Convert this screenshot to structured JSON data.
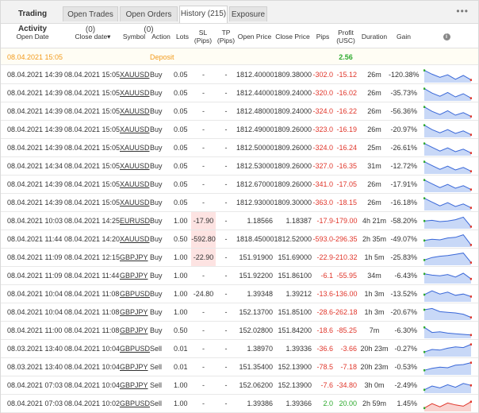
{
  "tabs": [
    {
      "label": "Trading Activity",
      "kind": "title"
    },
    {
      "label": "Open Trades (0)",
      "kind": "normal"
    },
    {
      "label": "Open Orders (0)",
      "kind": "normal"
    },
    {
      "label": "History (215)",
      "kind": "active"
    },
    {
      "label": "Exposure",
      "kind": "normal"
    }
  ],
  "more_label": "•••",
  "columns": {
    "open_date": "Open Date",
    "close_date": "Close date",
    "symbol": "Symbol",
    "action": "Action",
    "lots": "Lots",
    "sl": "SL (Pips)",
    "tp": "TP (Pips)",
    "open_price": "Open Price",
    "close_price": "Close Price",
    "pips": "Pips",
    "profit": "Profit (USC)",
    "duration": "Duration",
    "gain": "Gain"
  },
  "sort_indicator": "▾",
  "deposit": {
    "date": "08.04.2021 15:05",
    "label": "Deposit",
    "amount": "2.56"
  },
  "colors": {
    "red": "#e0362b",
    "green": "#2eaa2e",
    "orange": "#f29b1d",
    "line_blue": "#3a68d8",
    "fill_blue": "#c8d8f7",
    "line_red": "#e0362b",
    "fill_red": "#f9d3d0"
  },
  "trades": [
    {
      "open": "08.04.2021 14:39",
      "close": "08.04.2021 15:05",
      "symbol": "XAUUSD",
      "action": "Buy",
      "lots": "0.05",
      "sl": "-",
      "tp": "-",
      "open_price": "1812.40000",
      "close_price": "1809.38000",
      "pips": "-302.0",
      "profit": "-15.12",
      "duration": "26m",
      "gain": "-120.38%",
      "spark": [
        0.9,
        0.6,
        0.35,
        0.55,
        0.2,
        0.5,
        0.15
      ]
    },
    {
      "open": "08.04.2021 14:39",
      "close": "08.04.2021 15:05",
      "symbol": "XAUUSD",
      "action": "Buy",
      "lots": "0.05",
      "sl": "-",
      "tp": "-",
      "open_price": "1812.44000",
      "close_price": "1809.24000",
      "pips": "-320.0",
      "profit": "-16.02",
      "duration": "26m",
      "gain": "-35.73%",
      "spark": [
        0.9,
        0.55,
        0.3,
        0.6,
        0.25,
        0.5,
        0.15
      ]
    },
    {
      "open": "08.04.2021 14:39",
      "close": "08.04.2021 15:05",
      "symbol": "XAUUSD",
      "action": "Buy",
      "lots": "0.05",
      "sl": "-",
      "tp": "-",
      "open_price": "1812.48000",
      "close_price": "1809.24000",
      "pips": "-324.0",
      "profit": "-16.22",
      "duration": "26m",
      "gain": "-56.36%",
      "spark": [
        0.9,
        0.55,
        0.3,
        0.6,
        0.25,
        0.45,
        0.15
      ]
    },
    {
      "open": "08.04.2021 14:39",
      "close": "08.04.2021 15:05",
      "symbol": "XAUUSD",
      "action": "Buy",
      "lots": "0.05",
      "sl": "-",
      "tp": "-",
      "open_price": "1812.49000",
      "close_price": "1809.26000",
      "pips": "-323.0",
      "profit": "-16.19",
      "duration": "26m",
      "gain": "-20.97%",
      "spark": [
        0.9,
        0.55,
        0.3,
        0.55,
        0.25,
        0.45,
        0.15
      ]
    },
    {
      "open": "08.04.2021 14:39",
      "close": "08.04.2021 15:05",
      "symbol": "XAUUSD",
      "action": "Buy",
      "lots": "0.05",
      "sl": "-",
      "tp": "-",
      "open_price": "1812.50000",
      "close_price": "1809.26000",
      "pips": "-324.0",
      "profit": "-16.24",
      "duration": "25m",
      "gain": "-26.61%",
      "spark": [
        0.9,
        0.6,
        0.3,
        0.55,
        0.25,
        0.45,
        0.15
      ]
    },
    {
      "open": "08.04.2021 14:34",
      "close": "08.04.2021 15:05",
      "symbol": "XAUUSD",
      "action": "Buy",
      "lots": "0.05",
      "sl": "-",
      "tp": "-",
      "open_price": "1812.53000",
      "close_price": "1809.26000",
      "pips": "-327.0",
      "profit": "-16.35",
      "duration": "31m",
      "gain": "-12.72%",
      "spark": [
        0.9,
        0.6,
        0.3,
        0.55,
        0.25,
        0.45,
        0.15
      ]
    },
    {
      "open": "08.04.2021 14:39",
      "close": "08.04.2021 15:05",
      "symbol": "XAUUSD",
      "action": "Buy",
      "lots": "0.05",
      "sl": "-",
      "tp": "-",
      "open_price": "1812.67000",
      "close_price": "1809.26000",
      "pips": "-341.0",
      "profit": "-17.05",
      "duration": "26m",
      "gain": "-17.91%",
      "spark": [
        0.9,
        0.6,
        0.3,
        0.55,
        0.25,
        0.45,
        0.15
      ]
    },
    {
      "open": "08.04.2021 14:39",
      "close": "08.04.2021 15:05",
      "symbol": "XAUUSD",
      "action": "Buy",
      "lots": "0.05",
      "sl": "-",
      "tp": "-",
      "open_price": "1812.93000",
      "close_price": "1809.30000",
      "pips": "-363.0",
      "profit": "-18.15",
      "duration": "26m",
      "gain": "-16.18%",
      "spark": [
        0.9,
        0.6,
        0.3,
        0.55,
        0.25,
        0.45,
        0.15
      ]
    },
    {
      "open": "08.04.2021 10:03",
      "close": "08.04.2021 14:25",
      "symbol": "EURUSD",
      "action": "Buy",
      "lots": "1.00",
      "sl": "-17.90",
      "tp": "-",
      "open_price": "1.18566",
      "close_price": "1.18387",
      "pips": "-17.9",
      "profit": "-179.00",
      "duration": "4h 21m",
      "gain": "-58.20%",
      "spark": [
        0.55,
        0.6,
        0.5,
        0.55,
        0.65,
        0.85,
        0.1
      ]
    },
    {
      "open": "08.04.2021 11:44",
      "close": "08.04.2021 14:20",
      "symbol": "XAUUSD",
      "action": "Buy",
      "lots": "0.50",
      "sl": "-592.80",
      "tp": "-",
      "open_price": "1818.45000",
      "close_price": "1812.52000",
      "pips": "-593.0",
      "profit": "-296.35",
      "duration": "2h 35m",
      "gain": "-49.07%",
      "spark": [
        0.45,
        0.55,
        0.5,
        0.65,
        0.7,
        0.9,
        0.1
      ]
    },
    {
      "open": "08.04.2021 11:09",
      "close": "08.04.2021 12:15",
      "symbol": "GBPJPY",
      "action": "Buy",
      "lots": "1.00",
      "sl": "-22.90",
      "tp": "-",
      "open_price": "151.91900",
      "close_price": "151.69000",
      "pips": "-22.9",
      "profit": "-210.32",
      "duration": "1h 5m",
      "gain": "-25.83%",
      "spark": [
        0.35,
        0.55,
        0.65,
        0.7,
        0.8,
        0.9,
        0.15
      ]
    },
    {
      "open": "08.04.2021 11:09",
      "close": "08.04.2021 11:44",
      "symbol": "GBPJPY",
      "action": "Buy",
      "lots": "1.00",
      "sl": "-",
      "tp": "-",
      "open_price": "151.92200",
      "close_price": "151.86100",
      "pips": "-6.1",
      "profit": "-55.95",
      "duration": "34m",
      "gain": "-6.43%",
      "spark": [
        0.7,
        0.6,
        0.55,
        0.65,
        0.45,
        0.75,
        0.3
      ]
    },
    {
      "open": "08.04.2021 10:04",
      "close": "08.04.2021 11:08",
      "symbol": "GBPUSD",
      "action": "Buy",
      "lots": "1.00",
      "sl": "-24.80",
      "tp": "-",
      "open_price": "1.39348",
      "close_price": "1.39212",
      "pips": "-13.6",
      "profit": "-136.00",
      "duration": "1h 3m",
      "gain": "-13.52%",
      "spark": [
        0.5,
        0.8,
        0.55,
        0.7,
        0.45,
        0.55,
        0.35
      ]
    },
    {
      "open": "08.04.2021 10:04",
      "close": "08.04.2021 11:08",
      "symbol": "GBPJPY",
      "action": "Buy",
      "lots": "1.00",
      "sl": "-",
      "tp": "-",
      "open_price": "152.13700",
      "close_price": "151.85100",
      "pips": "-28.6",
      "profit": "-262.18",
      "duration": "1h 3m",
      "gain": "-20.67%",
      "spark": [
        0.75,
        0.85,
        0.6,
        0.55,
        0.5,
        0.4,
        0.15
      ]
    },
    {
      "open": "08.04.2021 11:00",
      "close": "08.04.2021 11:08",
      "symbol": "GBPJPY",
      "action": "Buy",
      "lots": "0.50",
      "sl": "-",
      "tp": "-",
      "open_price": "152.02800",
      "close_price": "151.84200",
      "pips": "-18.6",
      "profit": "-85.25",
      "duration": "7m",
      "gain": "-6.30%",
      "spark": [
        0.8,
        0.4,
        0.45,
        0.35,
        0.3,
        0.25,
        0.2
      ]
    },
    {
      "open": "08.03.2021 13:40",
      "close": "08.04.2021 10:04",
      "symbol": "GBPUSD",
      "action": "Sell",
      "lots": "0.01",
      "sl": "-",
      "tp": "-",
      "open_price": "1.38970",
      "close_price": "1.39336",
      "pips": "-36.6",
      "profit": "-3.66",
      "duration": "20h 23m",
      "gain": "-0.27%",
      "spark": [
        0.3,
        0.5,
        0.45,
        0.6,
        0.7,
        0.65,
        0.9
      ]
    },
    {
      "open": "08.03.2021 13:40",
      "close": "08.04.2021 10:04",
      "symbol": "GBPJPY",
      "action": "Sell",
      "lots": "0.01",
      "sl": "-",
      "tp": "-",
      "open_price": "151.35400",
      "close_price": "152.13900",
      "pips": "-78.5",
      "profit": "-7.18",
      "duration": "20h 23m",
      "gain": "-0.53%",
      "spark": [
        0.3,
        0.45,
        0.55,
        0.5,
        0.7,
        0.75,
        0.9
      ]
    },
    {
      "open": "08.04.2021 07:03",
      "close": "08.04.2021 10:04",
      "symbol": "GBPJPY",
      "action": "Sell",
      "lots": "1.00",
      "sl": "-",
      "tp": "-",
      "open_price": "152.06200",
      "close_price": "152.13900",
      "pips": "-7.6",
      "profit": "-34.80",
      "duration": "3h 0m",
      "gain": "-2.49%",
      "spark": [
        0.2,
        0.5,
        0.35,
        0.6,
        0.4,
        0.7,
        0.55
      ]
    },
    {
      "open": "08.04.2021 07:03",
      "close": "08.04.2021 10:02",
      "symbol": "GBPUSD",
      "action": "Sell",
      "lots": "1.00",
      "sl": "-",
      "tp": "-",
      "open_price": "1.39386",
      "close_price": "1.39366",
      "pips": "2.0",
      "profit": "20.00",
      "duration": "2h 59m",
      "gain": "1.45%",
      "spark": [
        0.2,
        0.55,
        0.3,
        0.6,
        0.45,
        0.35,
        0.7
      ]
    }
  ]
}
